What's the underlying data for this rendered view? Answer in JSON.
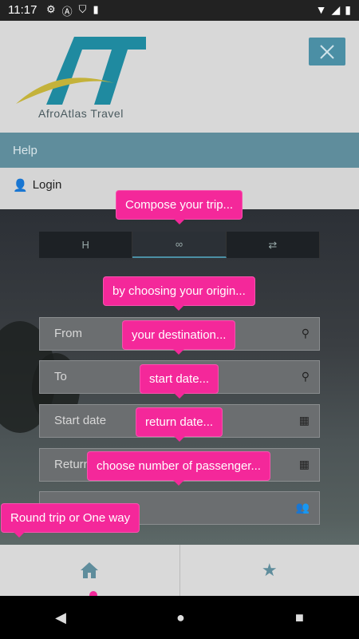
{
  "status": {
    "time": "11:17"
  },
  "header": {
    "logo_text": "AfroAtlas Travel",
    "close_icon": "close-icon"
  },
  "menu": {
    "help": "Help",
    "login": "Login"
  },
  "tabs": [
    {
      "label": "H",
      "icon": "hotel-icon"
    },
    {
      "label": "∞",
      "icon": "flight-icon"
    },
    {
      "label": "⇄",
      "icon": "round-trip-icon"
    }
  ],
  "form": {
    "from": "From",
    "to": "To",
    "start_date": "Start date",
    "return_date": "Return date"
  },
  "tooltips": {
    "compose": "Compose your trip...",
    "origin": "by choosing your origin...",
    "destination": "your destination...",
    "start": "start date...",
    "return": "return date...",
    "passengers": "choose number of passenger...",
    "roundtrip": "Round trip or One way"
  },
  "nav": {
    "home": "home-icon",
    "favorites": "star-icon"
  },
  "colors": {
    "accent": "#4b8fa5",
    "tooltip": "#f4289a"
  }
}
